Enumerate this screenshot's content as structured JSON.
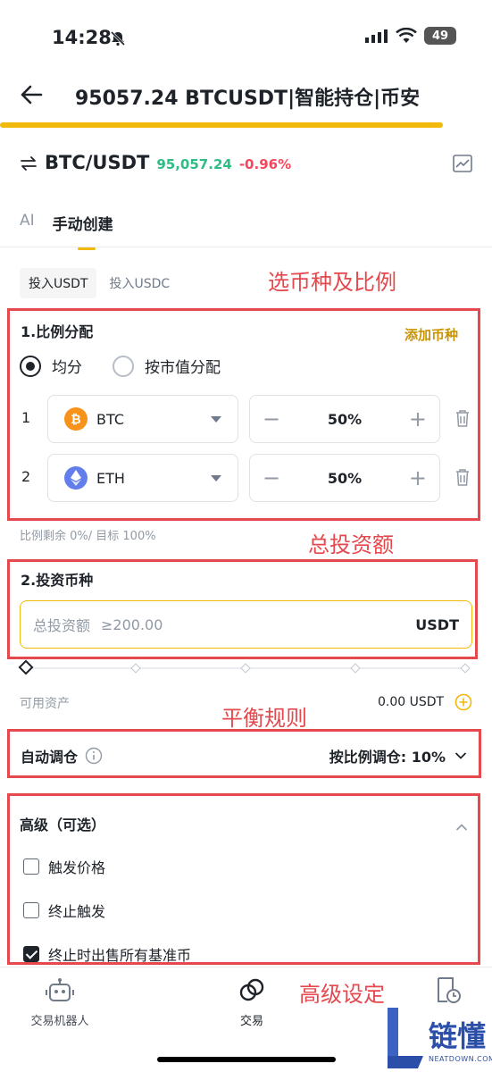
{
  "status_bar": {
    "time": "14:28",
    "battery": "49"
  },
  "header": {
    "title": "95057.24 BTCUSDT|智能持仓|币安",
    "back_icon": "arrow-left-icon"
  },
  "pair": {
    "name": "BTC/USDT",
    "price": "95,057.24",
    "change": "-0.96%"
  },
  "tabs": [
    {
      "label": "AI"
    },
    {
      "label": "手动创建"
    }
  ],
  "invest_tabs": [
    {
      "label": "投入USDT"
    },
    {
      "label": "投入USDC"
    }
  ],
  "annotations": {
    "select_coins": "选币种及比例",
    "total_investment": "总投资额",
    "balance_rules": "平衡规则",
    "advanced_settings": "高级设定"
  },
  "allocation": {
    "title": "1.比例分配",
    "add_coin": "添加币种",
    "options": [
      {
        "label": "均分",
        "selected": true
      },
      {
        "label": "按市值分配",
        "selected": false
      }
    ],
    "rows": [
      {
        "index": "1",
        "coin": "BTC",
        "percent": "50%",
        "icon_color": "#f7931a"
      },
      {
        "index": "2",
        "coin": "ETH",
        "percent": "50%",
        "icon_color": "#627eea"
      }
    ],
    "remaining": "比例剩余 0%/ 目标 100%"
  },
  "investment": {
    "title": "2.投资币种",
    "placeholder_label": "总投资额",
    "placeholder_value": "≥200.00",
    "currency": "USDT",
    "available_label": "可用资产",
    "available_value": "0.00 USDT"
  },
  "rebalance": {
    "label": "自动调仓",
    "value": "按比例调仓: 10%"
  },
  "advanced": {
    "title": "高级（可选）",
    "items": [
      {
        "label": "触发价格",
        "checked": false
      },
      {
        "label": "终止触发",
        "checked": false
      },
      {
        "label": "终止时出售所有基准币",
        "checked": true
      }
    ]
  },
  "bottom_nav": [
    {
      "label": "交易机器人",
      "icon": "robot-icon"
    },
    {
      "label": "交易",
      "icon": "trade-icon"
    }
  ],
  "watermark": {
    "text": "链懂",
    "subtext": "NEATDOWN.COM"
  }
}
